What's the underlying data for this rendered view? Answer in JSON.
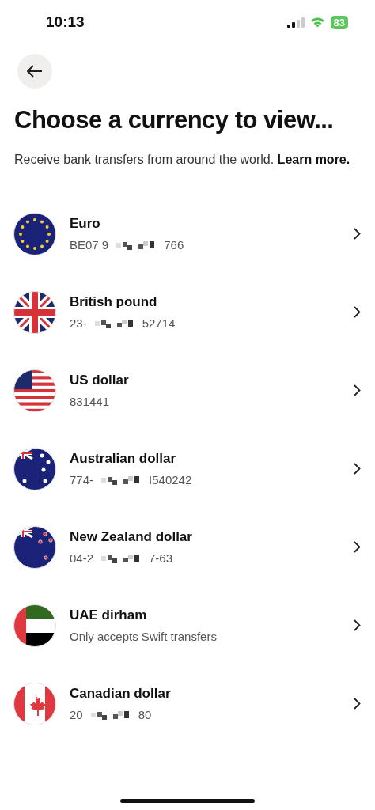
{
  "status_bar": {
    "time": "10:13",
    "battery": "83"
  },
  "title": "Choose a currency to view...",
  "subtitle": {
    "text": "Receive bank transfers from around the world.",
    "link": "Learn more."
  },
  "currencies": [
    {
      "kind": "eu",
      "name": "Euro",
      "detail": [
        "BE07 9",
        "766"
      ]
    },
    {
      "kind": "gb",
      "name": "British pound",
      "detail": [
        "23-",
        "52714"
      ]
    },
    {
      "kind": "us",
      "name": "US dollar",
      "detail": [
        "831441"
      ]
    },
    {
      "kind": "au",
      "name": "Australian dollar",
      "detail": [
        "774-",
        "I540242"
      ]
    },
    {
      "kind": "nz",
      "name": "New Zealand dollar",
      "detail": [
        "04-2",
        "7-63"
      ]
    },
    {
      "kind": "ae",
      "name": "UAE dirham",
      "detail": [
        "Only accepts Swift transfers"
      ]
    },
    {
      "kind": "ca",
      "name": "Canadian dollar",
      "detail": [
        "20",
        "80"
      ]
    }
  ]
}
